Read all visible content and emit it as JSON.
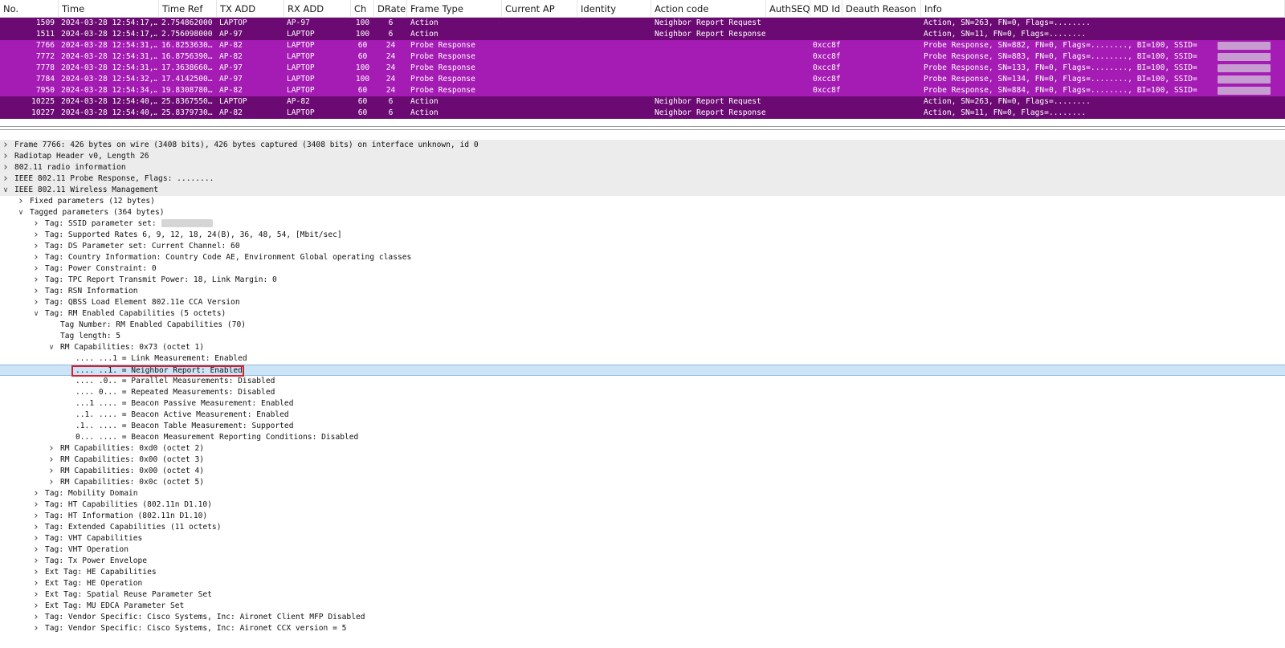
{
  "columns": [
    {
      "label": "No."
    },
    {
      "label": "Time"
    },
    {
      "label": "Time Ref"
    },
    {
      "label": "TX ADD"
    },
    {
      "label": "RX ADD"
    },
    {
      "label": "Ch"
    },
    {
      "label": "DRate"
    },
    {
      "label": "Frame Type"
    },
    {
      "label": "Current AP"
    },
    {
      "label": "Identity"
    },
    {
      "label": "Action code"
    },
    {
      "label": "AuthSEQ"
    },
    {
      "label": "MD Id"
    },
    {
      "label": "Deauth Reason"
    },
    {
      "label": "Info"
    }
  ],
  "packets": [
    {
      "no": "1509",
      "time": "2024-03-28 12:54:17,…",
      "time_ref": "2.754862000",
      "tx": "LAPTOP",
      "rx": "AP-97",
      "ch": "100",
      "drate": "6",
      "frame_type": "Action",
      "current_ap": "",
      "identity": "",
      "action_code": "Neighbor Report Request",
      "authseq": "",
      "md_id": "",
      "deauth": "",
      "info": "Action, SN=263, FN=0, Flags=........",
      "row_color": "#6b0a73",
      "blur": false
    },
    {
      "no": "1511",
      "time": "2024-03-28 12:54:17,…",
      "time_ref": "2.756098000",
      "tx": "AP-97",
      "rx": "LAPTOP",
      "ch": "100",
      "drate": "6",
      "frame_type": "Action",
      "current_ap": "",
      "identity": "",
      "action_code": "Neighbor Report Response",
      "authseq": "",
      "md_id": "",
      "deauth": "",
      "info": "Action, SN=11, FN=0, Flags=........",
      "row_color": "#6b0a73",
      "blur": false
    },
    {
      "no": "7766",
      "time": "2024-03-28 12:54:31,…",
      "time_ref": "16.8253630…",
      "tx": "AP-82",
      "rx": "LAPTOP",
      "ch": "60",
      "drate": "24",
      "frame_type": "Probe Response",
      "current_ap": "",
      "identity": "",
      "action_code": "",
      "authseq": "",
      "md_id": "0xcc8f",
      "deauth": "",
      "info": "Probe Response, SN=882, FN=0, Flags=........, BI=100, SSID=",
      "row_color": "#a51cb4",
      "blur": true
    },
    {
      "no": "7772",
      "time": "2024-03-28 12:54:31,…",
      "time_ref": "16.8756390…",
      "tx": "AP-82",
      "rx": "LAPTOP",
      "ch": "60",
      "drate": "24",
      "frame_type": "Probe Response",
      "current_ap": "",
      "identity": "",
      "action_code": "",
      "authseq": "",
      "md_id": "0xcc8f",
      "deauth": "",
      "info": "Probe Response, SN=883, FN=0, Flags=........, BI=100, SSID=",
      "row_color": "#a51cb4",
      "blur": true
    },
    {
      "no": "7778",
      "time": "2024-03-28 12:54:31,…",
      "time_ref": "17.3638660…",
      "tx": "AP-97",
      "rx": "LAPTOP",
      "ch": "100",
      "drate": "24",
      "frame_type": "Probe Response",
      "current_ap": "",
      "identity": "",
      "action_code": "",
      "authseq": "",
      "md_id": "0xcc8f",
      "deauth": "",
      "info": "Probe Response, SN=133, FN=0, Flags=........, BI=100, SSID=",
      "row_color": "#a51cb4",
      "blur": true
    },
    {
      "no": "7784",
      "time": "2024-03-28 12:54:32,…",
      "time_ref": "17.4142500…",
      "tx": "AP-97",
      "rx": "LAPTOP",
      "ch": "100",
      "drate": "24",
      "frame_type": "Probe Response",
      "current_ap": "",
      "identity": "",
      "action_code": "",
      "authseq": "",
      "md_id": "0xcc8f",
      "deauth": "",
      "info": "Probe Response, SN=134, FN=0, Flags=........, BI=100, SSID=",
      "row_color": "#a51cb4",
      "blur": true
    },
    {
      "no": "7950",
      "time": "2024-03-28 12:54:34,…",
      "time_ref": "19.8308780…",
      "tx": "AP-82",
      "rx": "LAPTOP",
      "ch": "60",
      "drate": "24",
      "frame_type": "Probe Response",
      "current_ap": "",
      "identity": "",
      "action_code": "",
      "authseq": "",
      "md_id": "0xcc8f",
      "deauth": "",
      "info": "Probe Response, SN=884, FN=0, Flags=........, BI=100, SSID=",
      "row_color": "#a51cb4",
      "blur": true
    },
    {
      "no": "10225",
      "time": "2024-03-28 12:54:40,…",
      "time_ref": "25.8367550…",
      "tx": "LAPTOP",
      "rx": "AP-82",
      "ch": "60",
      "drate": "6",
      "frame_type": "Action",
      "current_ap": "",
      "identity": "",
      "action_code": "Neighbor Report Request",
      "authseq": "",
      "md_id": "",
      "deauth": "",
      "info": "Action, SN=263, FN=0, Flags=........",
      "row_color": "#6b0a73",
      "blur": false
    },
    {
      "no": "10227",
      "time": "2024-03-28 12:54:40,…",
      "time_ref": "25.8379730…",
      "tx": "AP-82",
      "rx": "LAPTOP",
      "ch": "60",
      "drate": "6",
      "frame_type": "Action",
      "current_ap": "",
      "identity": "",
      "action_code": "Neighbor Report Response",
      "authseq": "",
      "md_id": "",
      "deauth": "",
      "info": "Action, SN=11, FN=0, Flags=........",
      "row_color": "#6b0a73",
      "blur": false
    }
  ],
  "tree": [
    {
      "level": 0,
      "arrow": "collapsed",
      "text": "Frame 7766: 426 bytes on wire (3408 bits), 426 bytes captured (3408 bits) on interface unknown, id 0",
      "style": "shaded"
    },
    {
      "level": 0,
      "arrow": "collapsed",
      "text": "Radiotap Header v0, Length 26",
      "style": "shaded"
    },
    {
      "level": 0,
      "arrow": "collapsed",
      "text": "802.11 radio information",
      "style": "shaded"
    },
    {
      "level": 0,
      "arrow": "collapsed",
      "text": "IEEE 802.11 Probe Response, Flags: ........",
      "style": "shaded"
    },
    {
      "level": 0,
      "arrow": "expanded",
      "text": "IEEE 802.11 Wireless Management",
      "style": "shaded"
    },
    {
      "level": 1,
      "arrow": "collapsed",
      "text": "Fixed parameters (12 bytes)",
      "style": ""
    },
    {
      "level": 1,
      "arrow": "expanded",
      "text": "Tagged parameters (364 bytes)",
      "style": ""
    },
    {
      "level": 2,
      "arrow": "collapsed",
      "text": "Tag: SSID parameter set:",
      "style": "",
      "ssid_blur": true
    },
    {
      "level": 2,
      "arrow": "collapsed",
      "text": "Tag: Supported Rates 6, 9, 12, 18, 24(B), 36, 48, 54, [Mbit/sec]",
      "style": ""
    },
    {
      "level": 2,
      "arrow": "collapsed",
      "text": "Tag: DS Parameter set: Current Channel: 60",
      "style": ""
    },
    {
      "level": 2,
      "arrow": "collapsed",
      "text": "Tag: Country Information: Country Code AE, Environment Global operating classes",
      "style": ""
    },
    {
      "level": 2,
      "arrow": "collapsed",
      "text": "Tag: Power Constraint: 0",
      "style": ""
    },
    {
      "level": 2,
      "arrow": "collapsed",
      "text": "Tag: TPC Report Transmit Power: 18, Link Margin: 0",
      "style": ""
    },
    {
      "level": 2,
      "arrow": "collapsed",
      "text": "Tag: RSN Information",
      "style": ""
    },
    {
      "level": 2,
      "arrow": "collapsed",
      "text": "Tag: QBSS Load Element 802.11e CCA Version",
      "style": ""
    },
    {
      "level": 2,
      "arrow": "expanded",
      "text": "Tag: RM Enabled Capabilities (5 octets)",
      "style": ""
    },
    {
      "level": 3,
      "arrow": "none",
      "text": "Tag Number: RM Enabled Capabilities (70)",
      "style": ""
    },
    {
      "level": 3,
      "arrow": "none",
      "text": "Tag length: 5",
      "style": ""
    },
    {
      "level": 3,
      "arrow": "expanded",
      "text": "RM Capabilities: 0x73 (octet 1)",
      "style": ""
    },
    {
      "level": 4,
      "arrow": "none",
      "text": ".... ...1 = Link Measurement: Enabled",
      "style": ""
    },
    {
      "level": 4,
      "arrow": "none",
      "text": ".... ..1. = Neighbor Report: Enabled",
      "style": "selected",
      "boxed": true
    },
    {
      "level": 4,
      "arrow": "none",
      "text": ".... .0.. = Parallel Measurements: Disabled",
      "style": ""
    },
    {
      "level": 4,
      "arrow": "none",
      "text": ".... 0... = Repeated Measurements: Disabled",
      "style": ""
    },
    {
      "level": 4,
      "arrow": "none",
      "text": "...1 .... = Beacon Passive Measurement: Enabled",
      "style": ""
    },
    {
      "level": 4,
      "arrow": "none",
      "text": "..1. .... = Beacon Active Measurement: Enabled",
      "style": ""
    },
    {
      "level": 4,
      "arrow": "none",
      "text": ".1.. .... = Beacon Table Measurement: Supported",
      "style": ""
    },
    {
      "level": 4,
      "arrow": "none",
      "text": "0... .... = Beacon Measurement Reporting Conditions: Disabled",
      "style": ""
    },
    {
      "level": 3,
      "arrow": "collapsed",
      "text": "RM Capabilities: 0xd0 (octet 2)",
      "style": ""
    },
    {
      "level": 3,
      "arrow": "collapsed",
      "text": "RM Capabilities: 0x00 (octet 3)",
      "style": ""
    },
    {
      "level": 3,
      "arrow": "collapsed",
      "text": "RM Capabilities: 0x00 (octet 4)",
      "style": ""
    },
    {
      "level": 3,
      "arrow": "collapsed",
      "text": "RM Capabilities: 0x0c (octet 5)",
      "style": ""
    },
    {
      "level": 2,
      "arrow": "collapsed",
      "text": "Tag: Mobility Domain",
      "style": ""
    },
    {
      "level": 2,
      "arrow": "collapsed",
      "text": "Tag: HT Capabilities (802.11n D1.10)",
      "style": ""
    },
    {
      "level": 2,
      "arrow": "collapsed",
      "text": "Tag: HT Information (802.11n D1.10)",
      "style": ""
    },
    {
      "level": 2,
      "arrow": "collapsed",
      "text": "Tag: Extended Capabilities (11 octets)",
      "style": ""
    },
    {
      "level": 2,
      "arrow": "collapsed",
      "text": "Tag: VHT Capabilities",
      "style": ""
    },
    {
      "level": 2,
      "arrow": "collapsed",
      "text": "Tag: VHT Operation",
      "style": ""
    },
    {
      "level": 2,
      "arrow": "collapsed",
      "text": "Tag: Tx Power Envelope",
      "style": ""
    },
    {
      "level": 2,
      "arrow": "collapsed",
      "text": "Ext Tag: HE Capabilities",
      "style": ""
    },
    {
      "level": 2,
      "arrow": "collapsed",
      "text": "Ext Tag: HE Operation",
      "style": ""
    },
    {
      "level": 2,
      "arrow": "collapsed",
      "text": "Ext Tag: Spatial Reuse Parameter Set",
      "style": ""
    },
    {
      "level": 2,
      "arrow": "collapsed",
      "text": "Ext Tag: MU EDCA Parameter Set",
      "style": ""
    },
    {
      "level": 2,
      "arrow": "collapsed",
      "text": "Tag: Vendor Specific: Cisco Systems, Inc: Aironet Client MFP Disabled",
      "style": ""
    },
    {
      "level": 2,
      "arrow": "collapsed",
      "text": "Tag: Vendor Specific: Cisco Systems, Inc: Aironet CCX version = 5",
      "style": ""
    }
  ],
  "colors": {
    "action_row": "#6b0a73",
    "probe_row": "#a51cb4",
    "selection": "#cce4f7",
    "highlight_box": "#d6202c"
  }
}
